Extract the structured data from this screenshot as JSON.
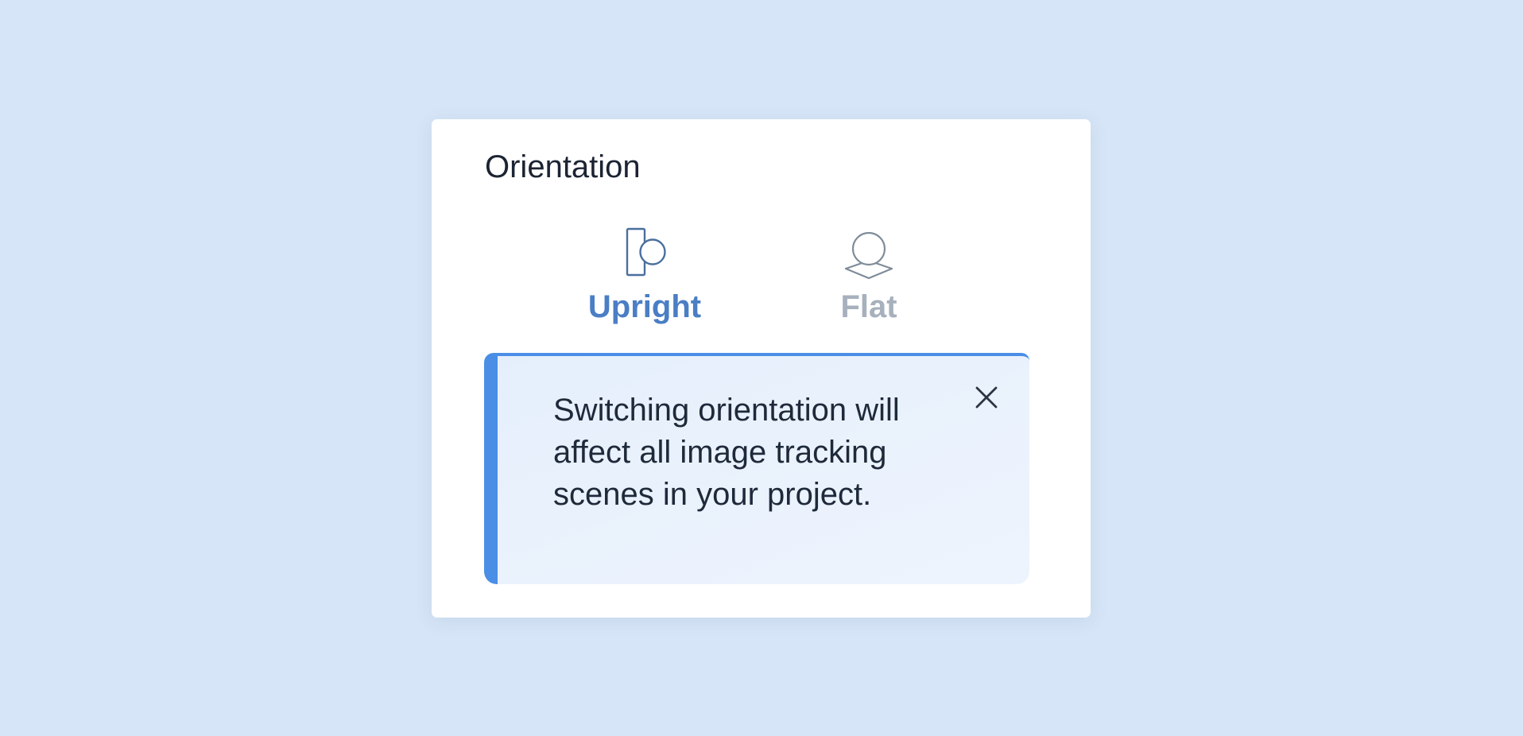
{
  "orientation": {
    "title": "Orientation",
    "options": [
      {
        "label": "Upright",
        "icon": "upright-orientation-icon",
        "selected": true,
        "color": "#4a7ec5"
      },
      {
        "label": "Flat",
        "icon": "flat-orientation-icon",
        "selected": false,
        "color": "#a7b1bd"
      }
    ]
  },
  "notice": {
    "message": "Switching orientation will affect all image tracking scenes in your project.",
    "close_icon": "close-icon",
    "accent_color": "#4a8ee6"
  }
}
